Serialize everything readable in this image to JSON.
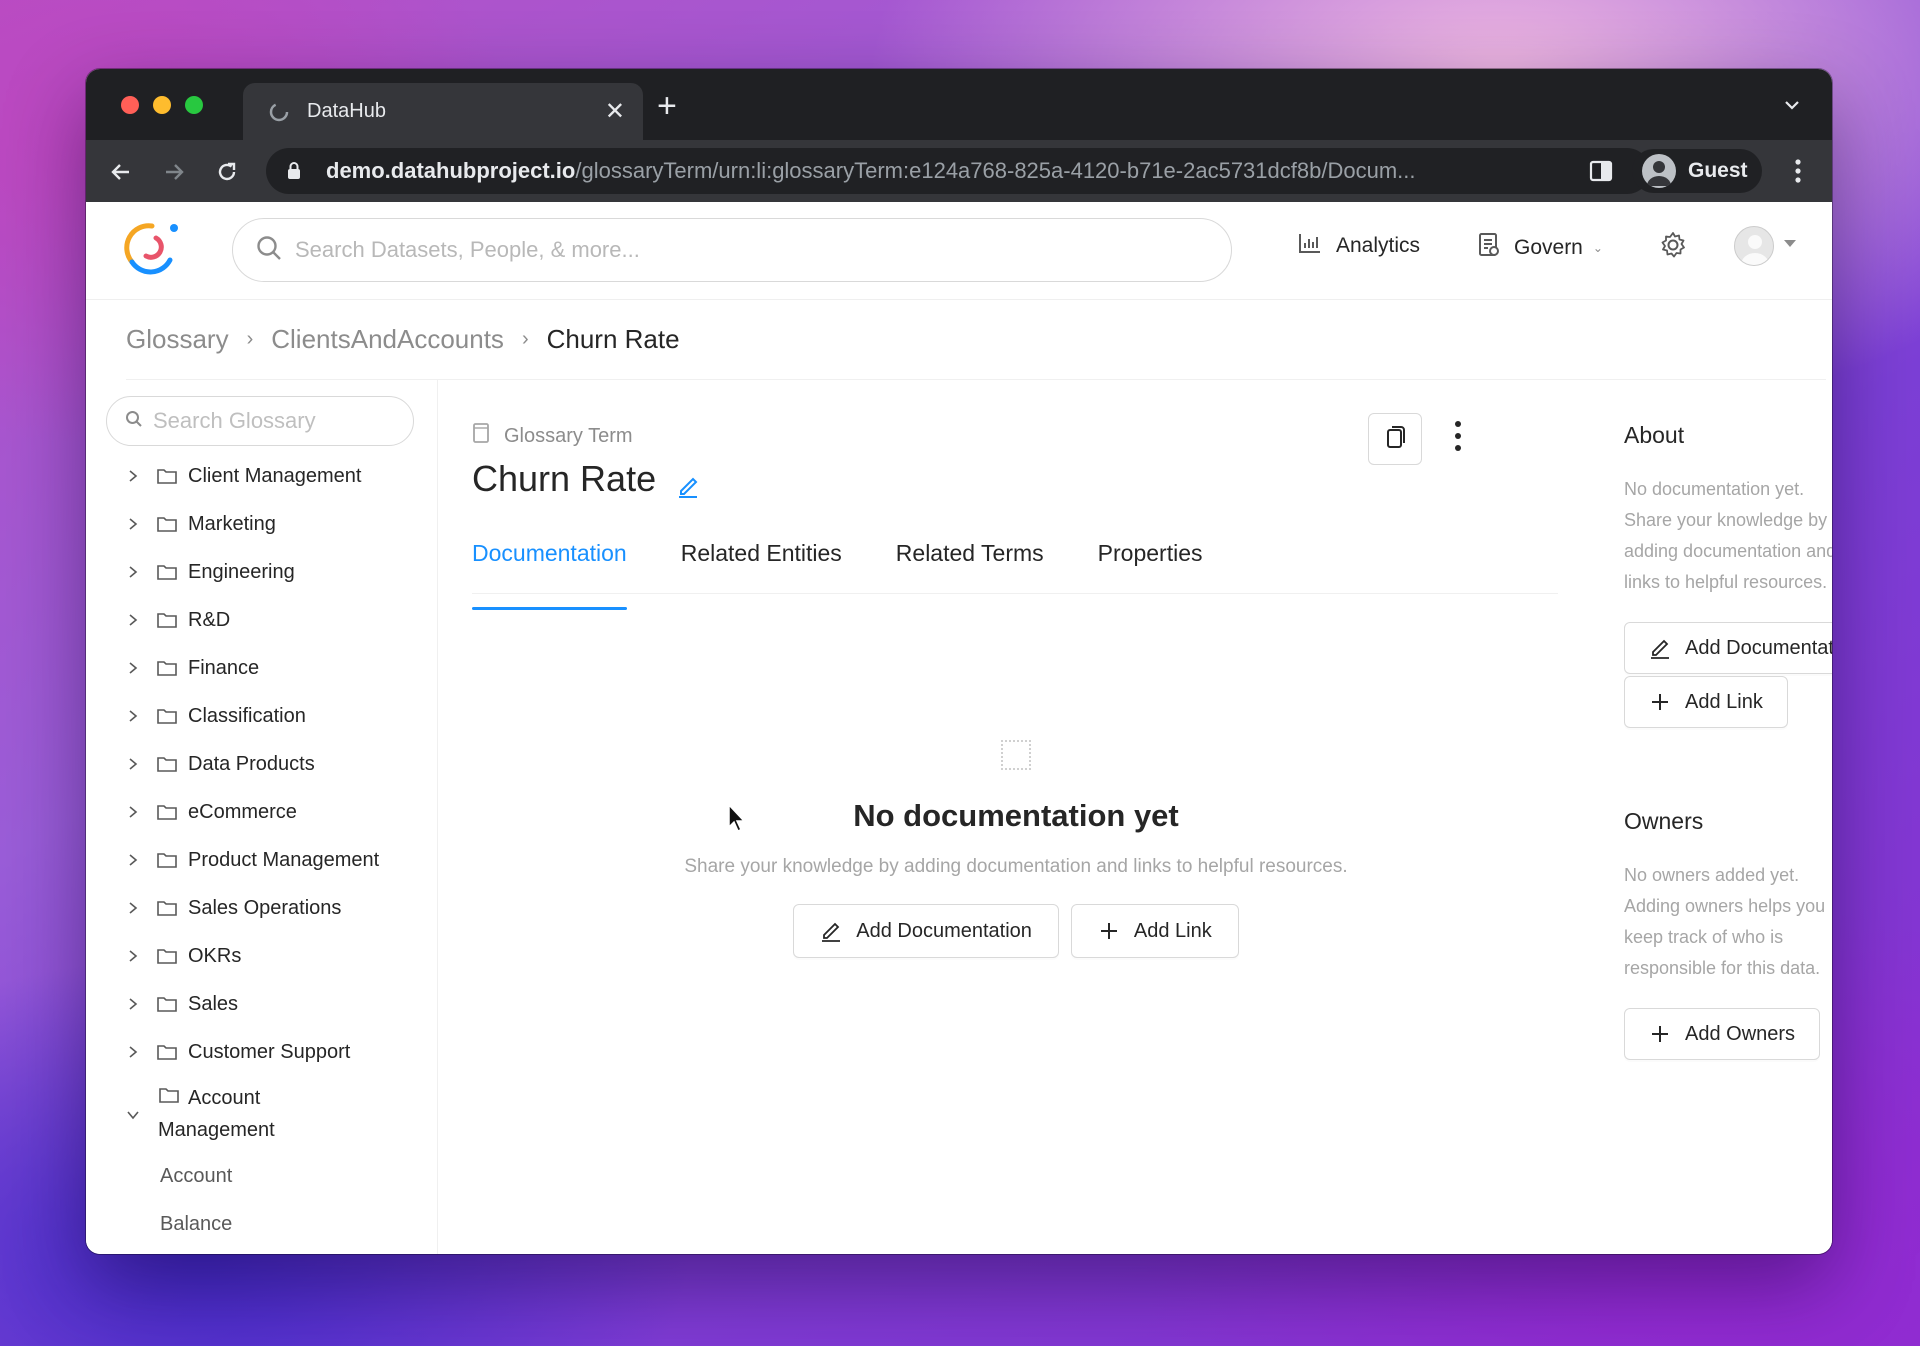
{
  "browser": {
    "tab_title": "DataHub",
    "url_host": "demo.datahubproject.io",
    "url_path": "/glossaryTerm/urn:li:glossaryTerm:e124a768-825a-4120-b71e-2ac5731dcf8b/Docum...",
    "profile_label": "Guest"
  },
  "header": {
    "search_placeholder": "Search Datasets, People, & more...",
    "analytics_label": "Analytics",
    "govern_label": "Govern"
  },
  "breadcrumb": [
    "Glossary",
    "ClientsAndAccounts",
    "Churn Rate"
  ],
  "sidebar": {
    "search_placeholder": "Search Glossary",
    "items": [
      "Client Management",
      "Marketing",
      "Engineering",
      "R&D",
      "Finance",
      "Classification",
      "Data Products",
      "eCommerce",
      "Product Management",
      "Sales Operations",
      "OKRs",
      "Sales",
      "Customer Support"
    ],
    "expanded_item": "Account Management",
    "children": [
      "Account",
      "Balance"
    ]
  },
  "entity": {
    "type_label": "Glossary Term",
    "title": "Churn Rate"
  },
  "tabs": [
    "Documentation",
    "Related Entities",
    "Related Terms",
    "Properties"
  ],
  "active_tab": "Documentation",
  "empty_state": {
    "title": "No documentation yet",
    "description": "Share your knowledge by adding documentation and links to helpful resources.",
    "add_documentation": "Add Documentation",
    "add_link": "Add Link"
  },
  "about": {
    "heading": "About",
    "text": "No documentation yet. Share your knowledge by adding documentation and links to helpful resources.",
    "add_documentation": "Add Documentation",
    "add_link": "Add Link"
  },
  "owners": {
    "heading": "Owners",
    "text": "No owners added yet. Adding owners helps you keep track of who is responsible for this data.",
    "add_owners": "Add Owners"
  },
  "colors": {
    "accent": "#1890ff",
    "text": "#262626",
    "muted": "#a6a6a6"
  }
}
